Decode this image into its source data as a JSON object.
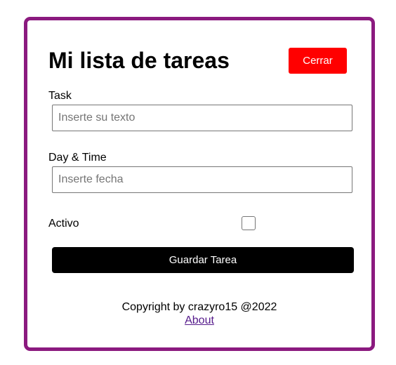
{
  "colors": {
    "border": "#8b1a7f",
    "close_button_bg": "#ff0000",
    "save_button_bg": "#000000",
    "link": "#551a8b"
  },
  "header": {
    "title": "Mi lista de tareas",
    "close_label": "Cerrar"
  },
  "form": {
    "task_label": "Task",
    "task_placeholder": "Inserte su texto",
    "task_value": "",
    "daytime_label": "Day & Time",
    "daytime_placeholder": "Inserte fecha",
    "daytime_value": "",
    "active_label": "Activo",
    "active_checked": false,
    "save_label": "Guardar Tarea"
  },
  "footer": {
    "copyright": "Copyright by crazyro15 @2022",
    "about_link": "About"
  }
}
